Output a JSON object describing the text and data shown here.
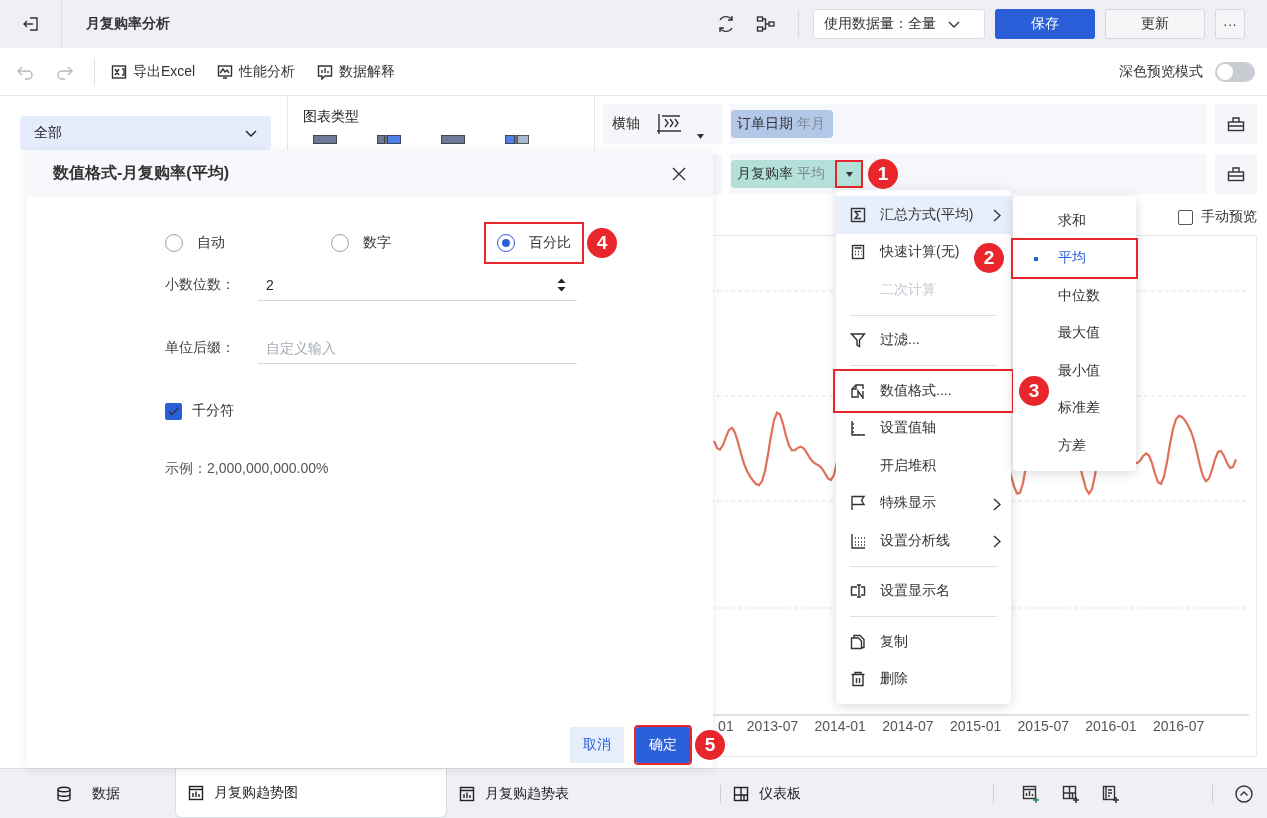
{
  "top_bar": {
    "title": "月复购率分析",
    "data_volume": "使用数据量：全量",
    "buttons": [
      {
        "label": "保存",
        "kind": "primary"
      },
      {
        "label": "更新",
        "kind": "default"
      },
      {
        "label": "···",
        "kind": "more"
      }
    ]
  },
  "toolbar": {
    "actions": [
      "导出Excel",
      "性能分析",
      "数据解释"
    ],
    "dark_preview": {
      "label": "深色预览模式",
      "on": false
    }
  },
  "field_panel": {
    "selector": "全部"
  },
  "chart_type_panel": {
    "title": "图表类型"
  },
  "axes": [
    {
      "label": "横轴",
      "field": "订单日期",
      "aggregation": "年月",
      "color": "#b3c7e8",
      "dropdown": false
    },
    {
      "field": "月复购率",
      "aggregation": "平均",
      "color": "#b3e0d8",
      "dropdown": true,
      "callout": "1"
    }
  ],
  "manual_preview": {
    "label": "手动预览",
    "checked": false
  },
  "chart": {
    "x_labels": [
      "01",
      "2013-07",
      "2014-01",
      "2014-07",
      "2015-01",
      "2015-07",
      "2016-01",
      "2016-07"
    ]
  },
  "dialog": {
    "title": "数值格式-月复购率(平均)",
    "formats": [
      {
        "label": "自动",
        "selected": false
      },
      {
        "label": "数字",
        "selected": false
      },
      {
        "label": "百分比",
        "selected": true,
        "callout": "4"
      }
    ],
    "decimals": {
      "label": "小数位数：",
      "value": "2"
    },
    "suffix": {
      "label": "单位后缀：",
      "placeholder": "自定义输入"
    },
    "thousands_separator": {
      "label": "千分符",
      "checked": true
    },
    "example": "示例：2,000,000,000.00%",
    "buttons": [
      {
        "label": "取消",
        "kind": "secondary"
      },
      {
        "label": "确定",
        "kind": "primary",
        "callout": "5"
      }
    ]
  },
  "context_menu": {
    "items": [
      {
        "kind": "item",
        "label": "汇总方式(平均)",
        "submenu": true,
        "highlighted": true,
        "disabled": false
      },
      {
        "kind": "item",
        "label": "快速计算(无)",
        "submenu": false,
        "highlighted": false,
        "disabled": false
      },
      {
        "kind": "item",
        "label": "二次计算",
        "submenu": false,
        "highlighted": false,
        "disabled": true
      },
      {
        "kind": "divider"
      },
      {
        "kind": "item",
        "label": "过滤...",
        "submenu": false,
        "highlighted": false,
        "disabled": false
      },
      {
        "kind": "divider"
      },
      {
        "kind": "item",
        "label": "数值格式....",
        "submenu": false,
        "highlighted": false,
        "disabled": false,
        "callout": "3"
      },
      {
        "kind": "item",
        "label": "设置值轴",
        "submenu": false,
        "highlighted": false,
        "disabled": false
      },
      {
        "kind": "item",
        "label": "开启堆积",
        "submenu": false,
        "highlighted": false,
        "disabled": false
      },
      {
        "kind": "item",
        "label": "特殊显示",
        "submenu": true,
        "highlighted": false,
        "disabled": false
      },
      {
        "kind": "item",
        "label": "设置分析线",
        "submenu": true,
        "highlighted": false,
        "disabled": false
      },
      {
        "kind": "divider"
      },
      {
        "kind": "item",
        "label": "设置显示名",
        "submenu": false,
        "highlighted": false,
        "disabled": false
      },
      {
        "kind": "divider"
      },
      {
        "kind": "item",
        "label": "复制",
        "submenu": false,
        "highlighted": false,
        "disabled": false
      },
      {
        "kind": "item",
        "label": "删除",
        "submenu": false,
        "highlighted": false,
        "disabled": false
      }
    ]
  },
  "submenu": {
    "items": [
      {
        "label": "求和",
        "selected": false
      },
      {
        "label": "平均",
        "selected": true,
        "callout": "2"
      },
      {
        "label": "中位数",
        "selected": false
      },
      {
        "label": "最大值",
        "selected": false
      },
      {
        "label": "最小值",
        "selected": false
      },
      {
        "label": "标准差",
        "selected": false
      },
      {
        "label": "方差",
        "selected": false
      }
    ]
  },
  "bottom_tabs": {
    "tabs": [
      {
        "label": "数据",
        "kind": "data",
        "selected": false
      },
      {
        "label": "月复购趋势图",
        "kind": "chart",
        "selected": true
      },
      {
        "label": "月复购趋势表",
        "kind": "chart",
        "selected": false
      },
      {
        "label": "仪表板",
        "kind": "dashboard",
        "selected": false
      }
    ]
  }
}
